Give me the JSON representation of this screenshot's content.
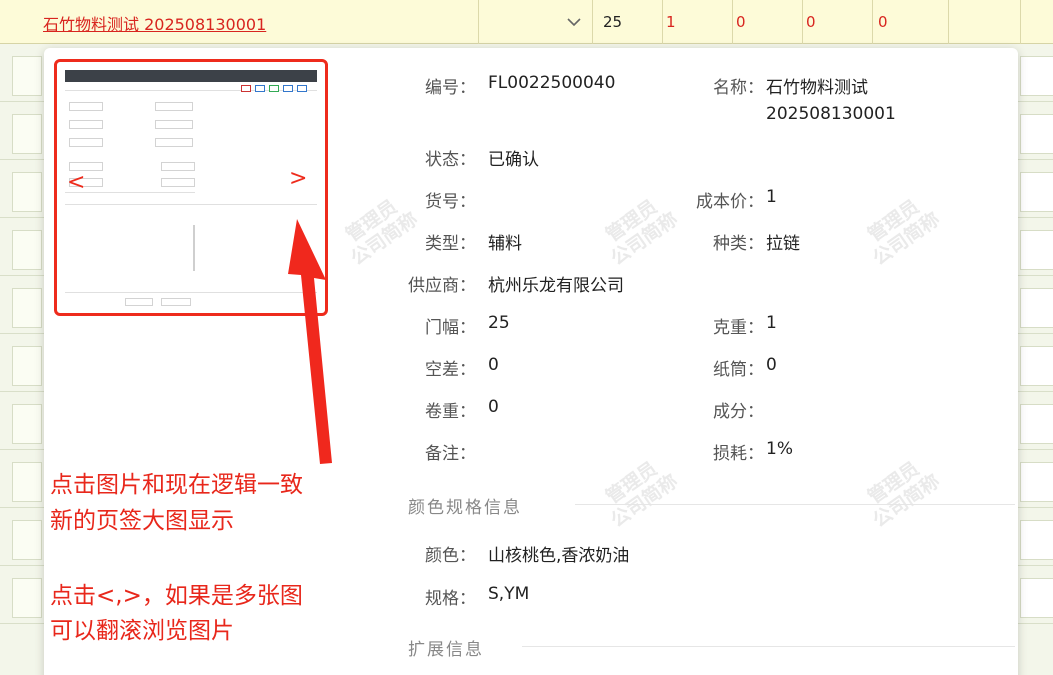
{
  "top_row": {
    "material_link": "石竹物料测试 202508130001",
    "width_value": "25",
    "count_1": "1",
    "count_2": "0",
    "count_3": "0",
    "count_4": "0"
  },
  "detail": {
    "code_label": "编号：",
    "code_value": "FL0022500040",
    "name_label": "名称：",
    "name_value_line1": "石竹物料测试",
    "name_value_line2": "202508130001",
    "status_label": "状态：",
    "status_value": "已确认",
    "sku_label": "货号：",
    "sku_value": "",
    "cost_label": "成本价：",
    "cost_value": "1",
    "type_label": "类型：",
    "type_value": "辅料",
    "kind_label": "种类：",
    "kind_value": "拉链",
    "supplier_label": "供应商：",
    "supplier_value": "杭州乐龙有限公司",
    "width_label": "门幅：",
    "width_value": "25",
    "gram_label": "克重：",
    "gram_value": "1",
    "air_gap_label": "空差：",
    "air_gap_value": "0",
    "tube_label": "纸筒：",
    "tube_value": "0",
    "roll_weight_label": "卷重：",
    "roll_weight_value": "0",
    "composition_label": "成分：",
    "composition_value": "",
    "remark_label": "备注：",
    "remark_value": "",
    "loss_label": "损耗：",
    "loss_value": "1%"
  },
  "color_section": {
    "title": "颜色规格信息",
    "color_label": "颜色：",
    "color_value": "山核桃色,香浓奶油",
    "spec_label": "规格：",
    "spec_value": "S,YM"
  },
  "ext_section": {
    "title": "扩展信息"
  },
  "carousel": {
    "prev": "<",
    "next": ">"
  },
  "annotation": {
    "line1": "点击图片和现在逻辑一致",
    "line2": "新的页签大图显示",
    "line3": "点击<,>，如果是多张图",
    "line4": "可以翻滚浏览图片"
  },
  "watermark": {
    "line1": "管理员",
    "line2": "公司简称"
  },
  "colors": {
    "accent_red": "#ee2b1c",
    "link_red": "#d8251f",
    "row_yellow": "#fdfbd8"
  }
}
